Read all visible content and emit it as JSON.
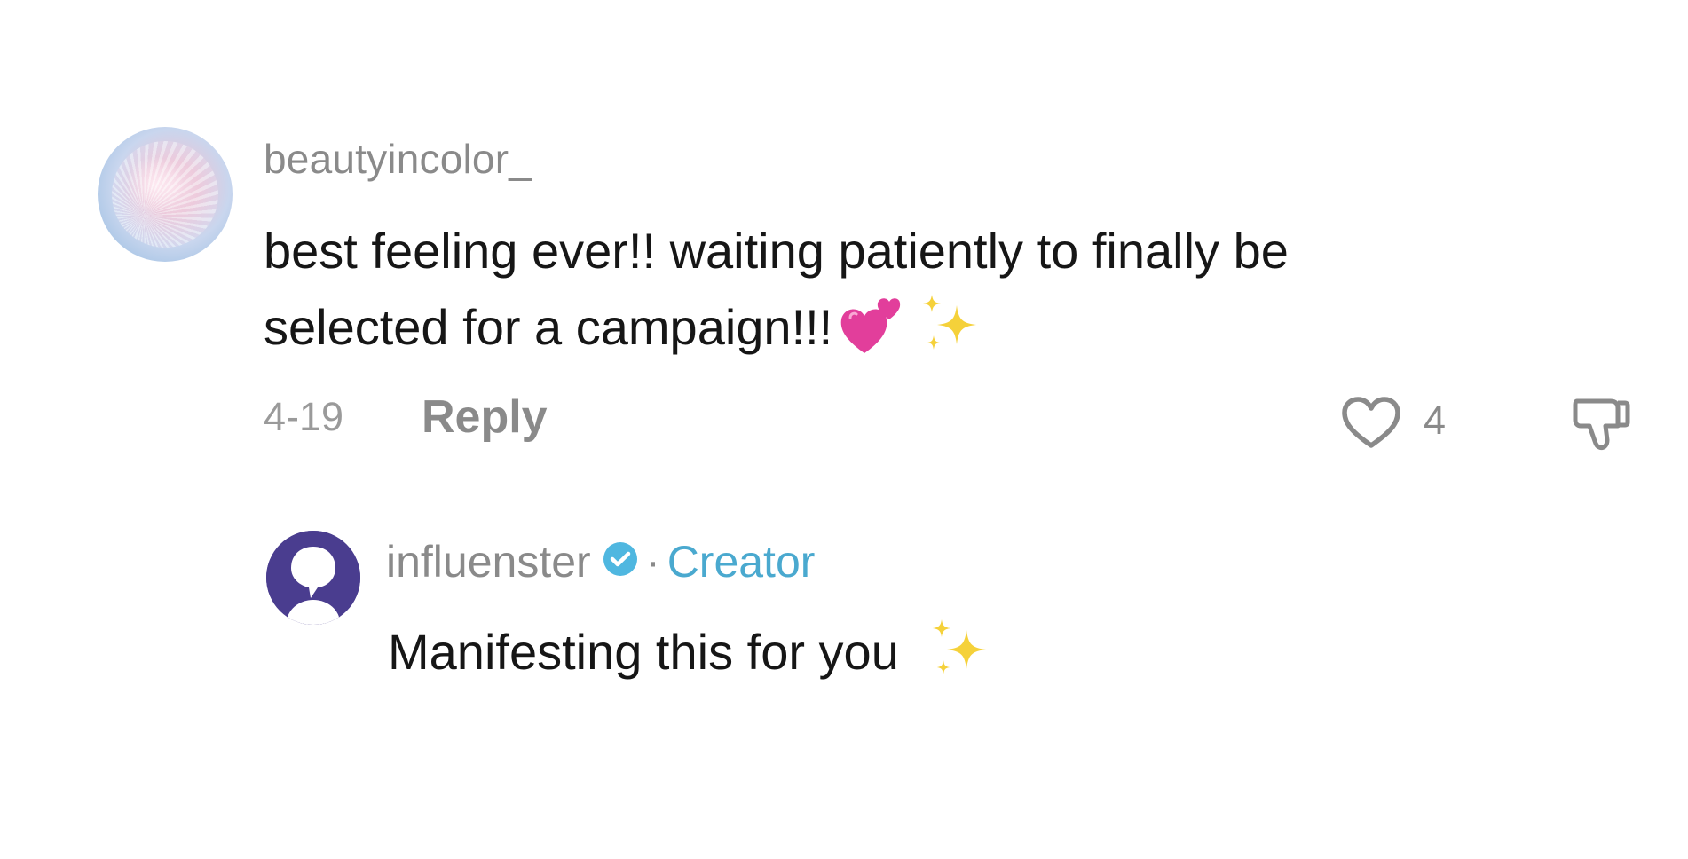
{
  "comment": {
    "username": "beautyincolor_",
    "text_line1": "best feeling ever!! waiting patiently to finally be",
    "text_line2": "selected for a campaign!!!",
    "emojis": [
      "two-hearts-emoji",
      "sparkles-emoji"
    ],
    "date": "4-19",
    "reply_label": "Reply",
    "like_count": "4"
  },
  "reply": {
    "username": "influenster",
    "verified": true,
    "separator": "·",
    "creator_label": "Creator",
    "text": "Manifesting this for you",
    "emojis": [
      "sparkles-emoji"
    ]
  },
  "colors": {
    "meta_gray": "#8a8a8a",
    "text_dark": "#161616",
    "creator_blue": "#4aa9cf",
    "verified_blue": "#4fb7e0",
    "reply_avatar_purple": "#4a3d8f",
    "heart_pink": "#e23e9b",
    "sparkle_yellow": "#f5d13a"
  },
  "icons": {
    "like": "heart-outline-icon",
    "dislike": "thumbs-down-outline-icon",
    "verified": "verified-check-icon"
  }
}
